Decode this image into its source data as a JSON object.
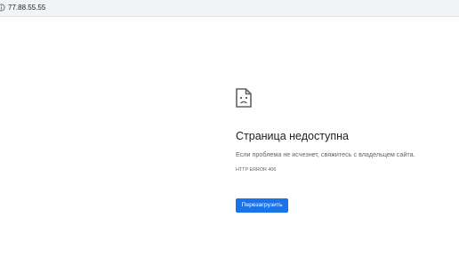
{
  "address_bar": {
    "url": "77.88.55.55",
    "info_icon": "info-icon"
  },
  "error_page": {
    "icon": "sad-page-icon",
    "title": "Страница недоступна",
    "message": "Если проблема не исчезнет, свяжитесь с владельцем сайта.",
    "error_code": "HTTP ERROR 406",
    "reload_label": "Перезагрузить",
    "accent_color": "#1a73e8"
  }
}
